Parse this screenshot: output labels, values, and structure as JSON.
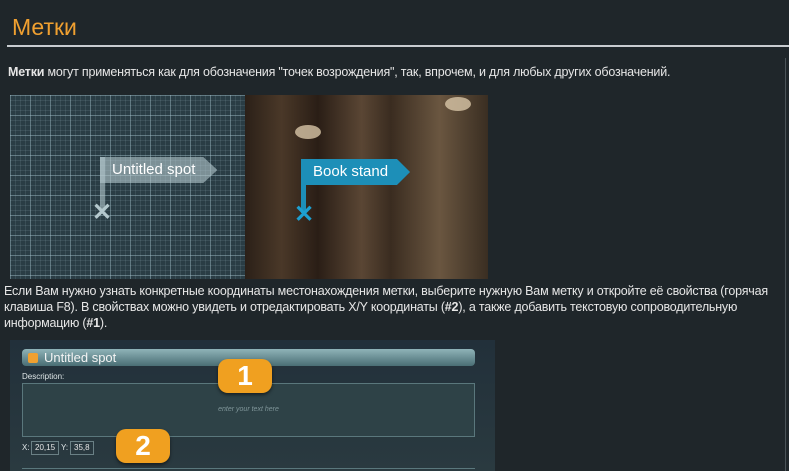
{
  "header": {
    "title": "Метки"
  },
  "intro": {
    "bold": "Метки",
    "text": " могут применяться как для обозначения \"точек возрождения\", так, впрочем, и для любых других обозначений."
  },
  "map_example": {
    "spot_label_default": "Untitled spot",
    "spot_label_named": "Book stand",
    "default_color": "#b4c8cd",
    "named_color": "#1d8fb8"
  },
  "para2": {
    "t1": "Если Вам нужно узнать конкретные координаты местонахождения метки, выберите нужную Вам метку и откройте её свойства (горячая клавиша F8). В свойствах можно увидеть и отредактировать X/Y координаты (",
    "b1": "#2",
    "t2": "), а также добавить текстовую сопроводительную информацию (",
    "b2": "#1",
    "t3": ")."
  },
  "properties": {
    "title": "Untitled spot",
    "description_label": "Description:",
    "description_placeholder": "enter your text here",
    "x_label": "X:",
    "x_value": "20,15",
    "y_label": "Y:",
    "y_value": "35,8",
    "callout1": "1",
    "callout2": "2"
  },
  "colors": {
    "accent": "#f0a030",
    "background": "#1f262a"
  }
}
